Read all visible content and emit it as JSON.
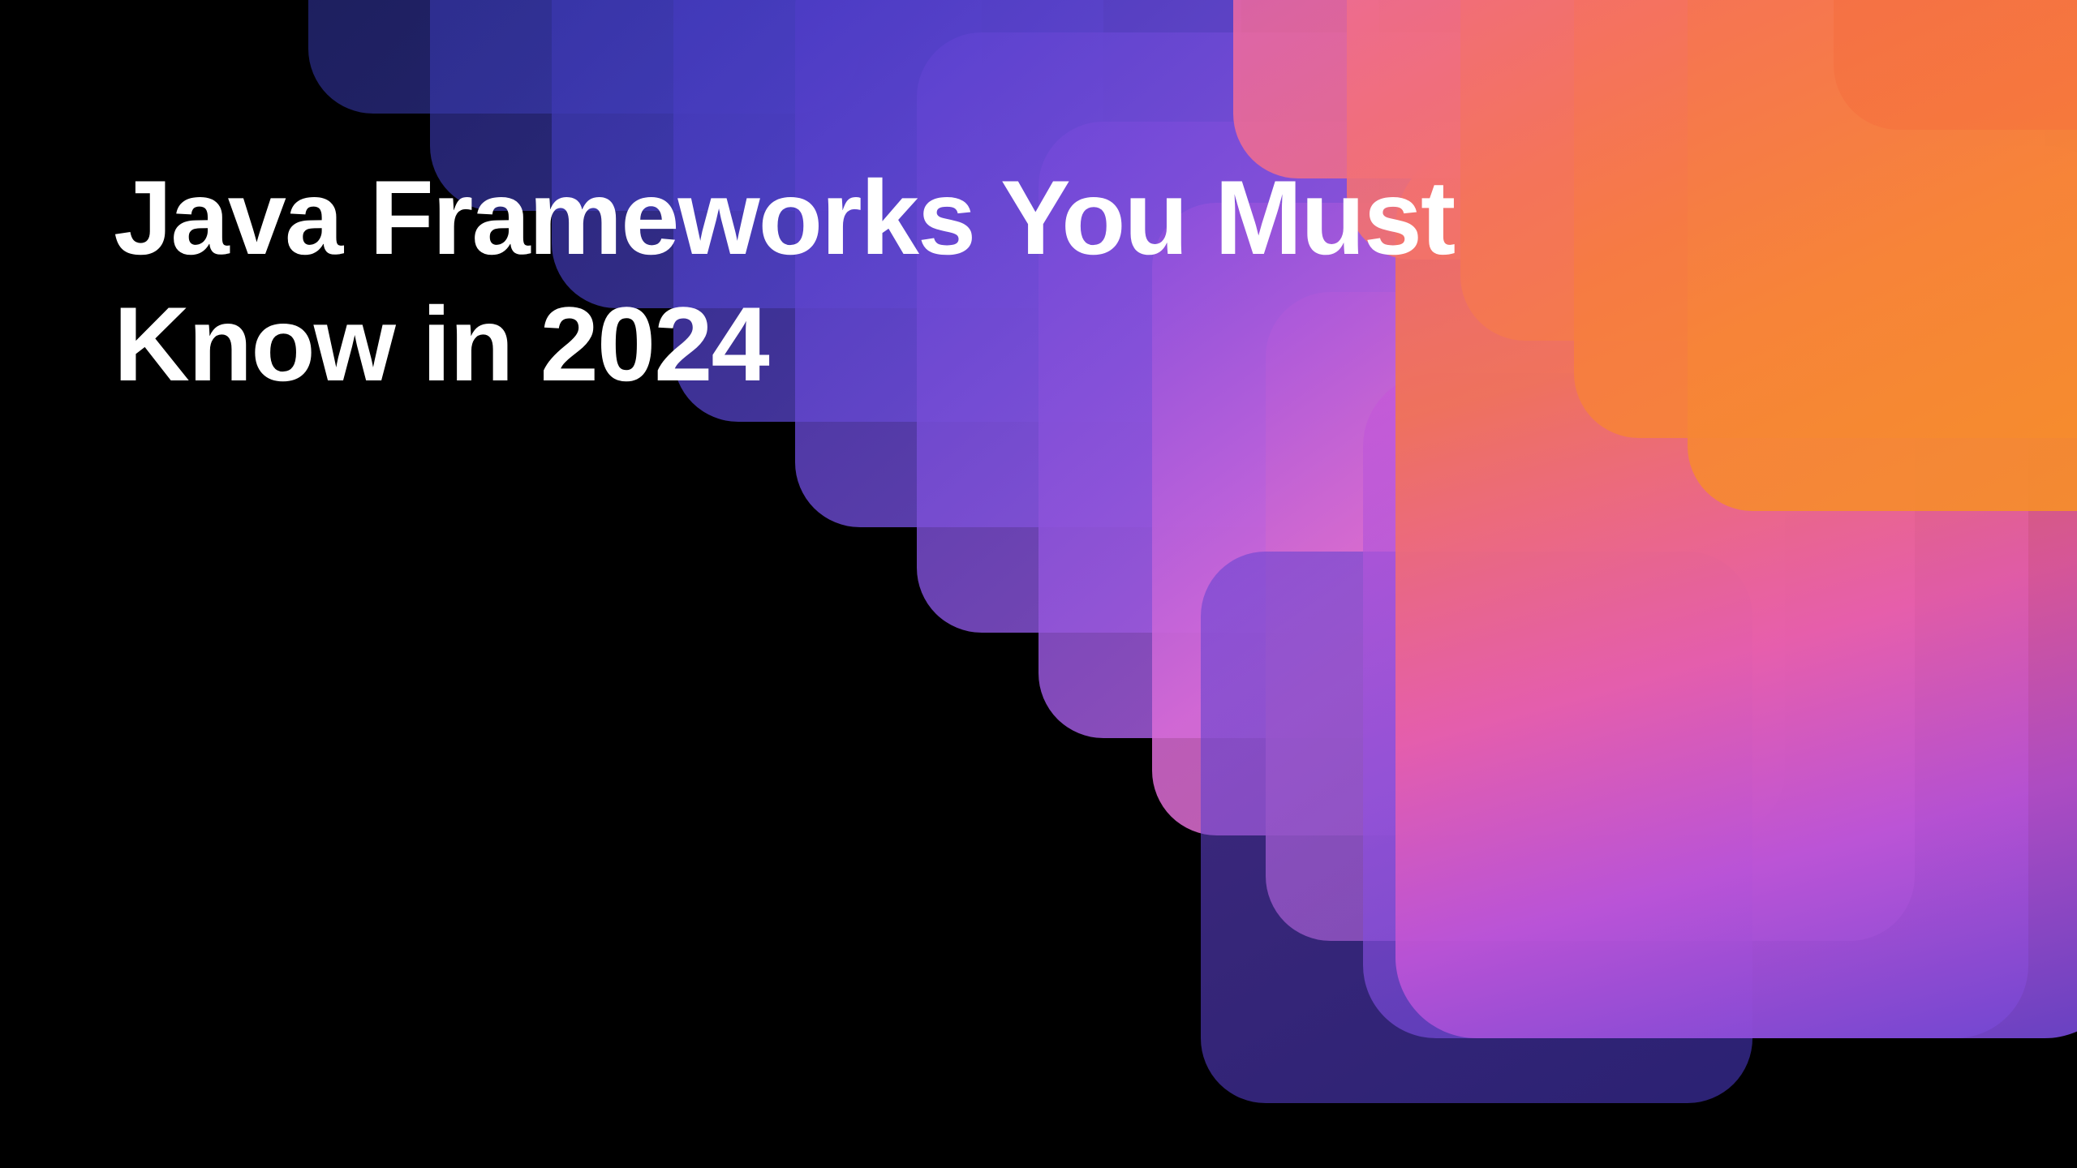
{
  "hero": {
    "title_line1": "Java Frameworks You Must",
    "title_line2": "Know in 2024"
  },
  "colors": {
    "background": "#000000",
    "text": "#ffffff",
    "gradient_start": "#3432a8",
    "gradient_mid": "#c166de",
    "gradient_end": "#f5823a"
  }
}
